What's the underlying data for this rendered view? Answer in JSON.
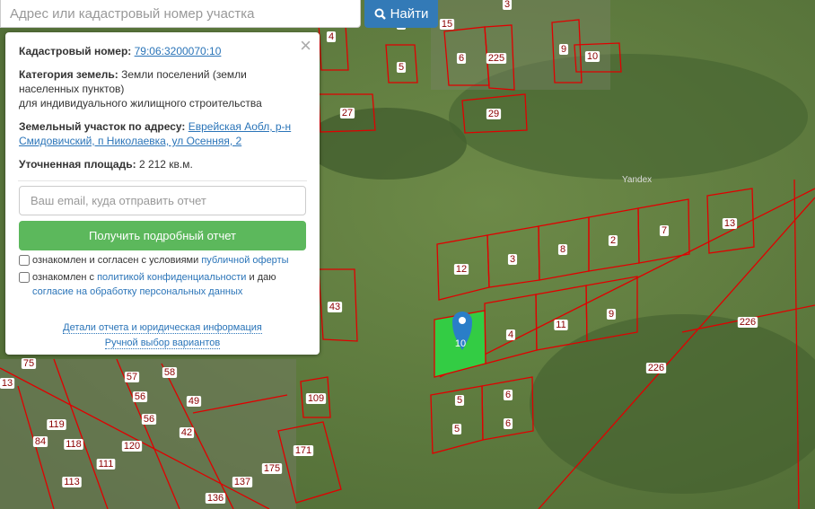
{
  "search": {
    "placeholder": "Адрес или кадастровый номер участка",
    "button_label": "Найти",
    "icon": "search-icon"
  },
  "panel": {
    "cadastral_label": "Кадастровый номер:",
    "cadastral_value": "79:06:3200070:10",
    "category_label": "Категория земель:",
    "category_value_1": "Земли поселений (земли",
    "category_value_2": "населенных пунктов)",
    "category_value_3": "для индивидуального жилищного строительства",
    "address_label": "Земельный участок по адресу:",
    "address_value_1": "Еврейская Аобл, р-н",
    "address_value_2": "Смидовичский, п Николаевка, ул Осенняя, 2",
    "area_label": "Уточненная площадь:",
    "area_value": "2 212 кв.м.",
    "email_placeholder": "Ваш email, куда отправить отчет",
    "report_button": "Получить подробный отчет",
    "agree1_text": "ознакомлен и согласен с условиями",
    "agree1_link": "публичной оферты",
    "agree2_text": "ознакомлен с",
    "agree2_link": "политикой конфиденциальности",
    "agree2_mid": "и даю",
    "agree2_link2": "согласие на обработку персональных данных",
    "details_link": "Детали отчета и юридическая информация",
    "manual_link": "Ручной выбор вариантов",
    "close": "×"
  },
  "map": {
    "watermark": "Yandex",
    "selected_label": "10",
    "parcels": [
      "15",
      "5",
      "6",
      "225",
      "9",
      "10",
      "4",
      "5",
      "27",
      "29",
      "13",
      "7",
      "2",
      "8",
      "3",
      "12",
      "4",
      "11",
      "9",
      "226",
      "226",
      "43",
      "5",
      "6",
      "5",
      "6",
      "109",
      "171",
      "175",
      "137",
      "136",
      "113",
      "111",
      "120",
      "118",
      "119",
      "84",
      "42",
      "56",
      "56",
      "49",
      "58",
      "57",
      "75",
      "13",
      "3"
    ]
  },
  "colors": {
    "parcel_border": "#e00000",
    "selected_fill": "#33cc44",
    "accent": "#337ab7",
    "button": "#5cb85c"
  }
}
